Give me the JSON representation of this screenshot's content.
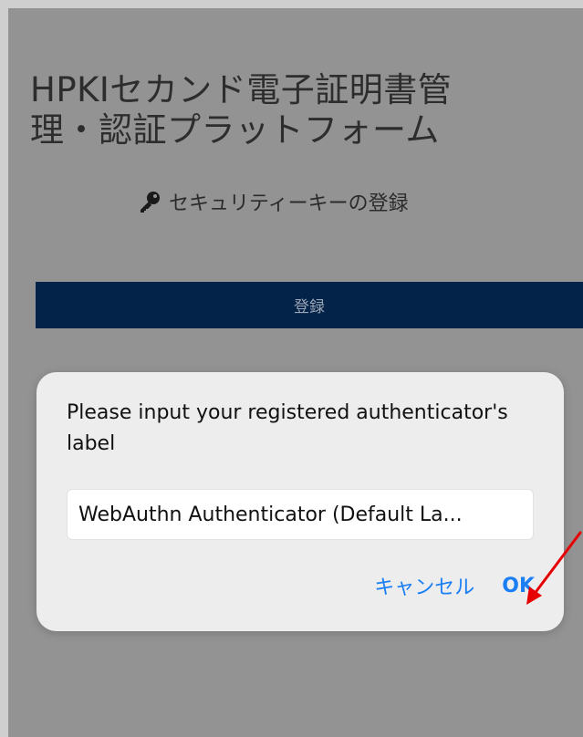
{
  "app": {
    "title": "HPKIセカンド電子証明書管理・認証プラットフォーム"
  },
  "page": {
    "subtitle": "セキュリティーキーの登録",
    "subtitle_icon": "key-icon",
    "register_button_label": "登録"
  },
  "dialog": {
    "message": "Please input your registered authenticator's label",
    "input_value": "WebAuthn Authenticator (Default La...",
    "cancel_label": "キャンセル",
    "ok_label": "OK"
  },
  "annotation": {
    "type": "red-arrow",
    "points_to": "ok-button",
    "color": "#e60000"
  },
  "colors": {
    "background_overlay": "#939393",
    "button_navy": "#042348",
    "dialog_bg": "#ededed",
    "link_blue": "#1a7ef5"
  }
}
